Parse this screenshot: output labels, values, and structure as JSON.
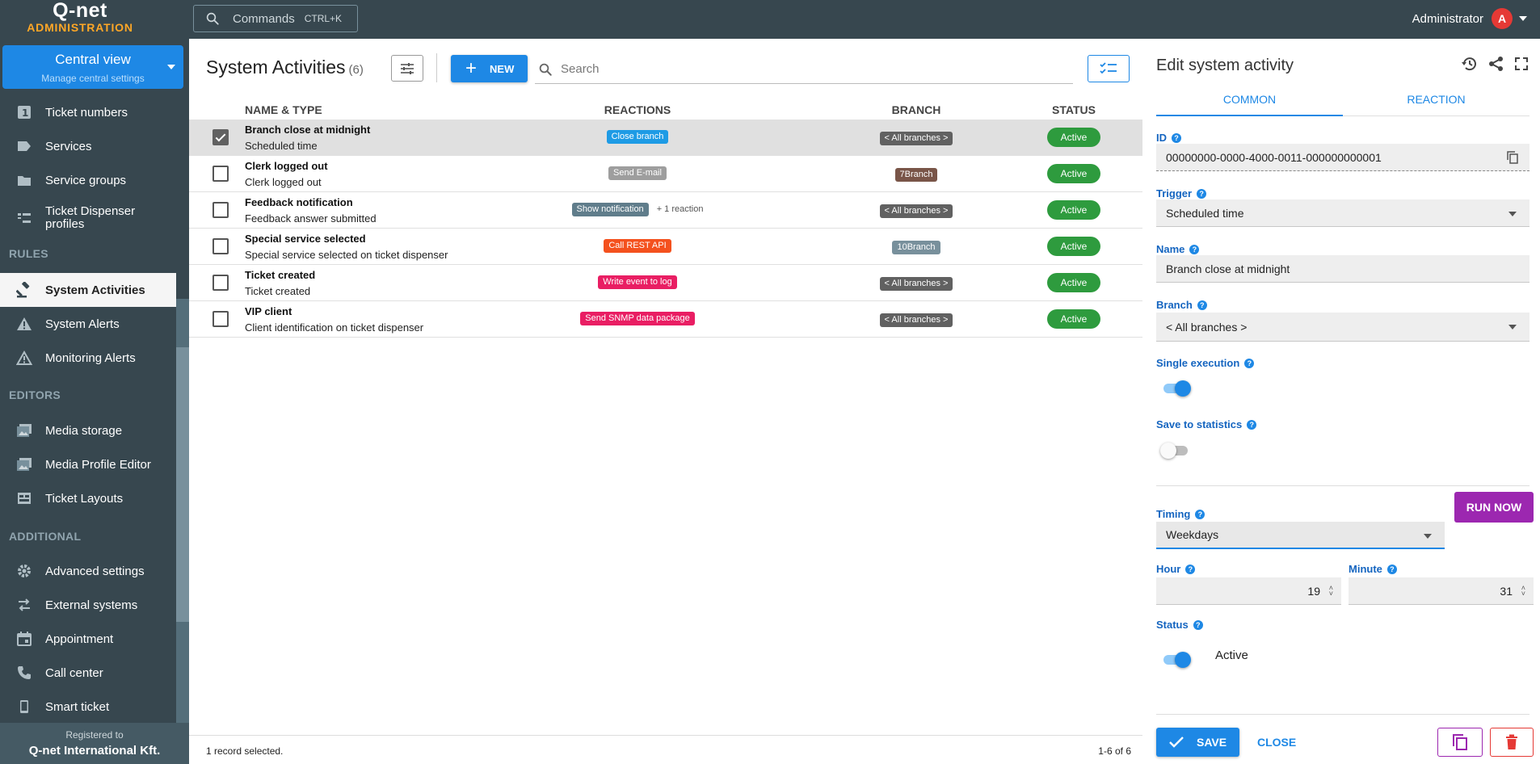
{
  "header": {
    "logo": "Q-net",
    "logo_sub": "ADMINISTRATION",
    "commands_label": "Commands",
    "commands_shortcut": "CTRL+K",
    "user_name": "Administrator",
    "user_initial": "A"
  },
  "sidebar": {
    "central": {
      "title": "Central view",
      "subtitle": "Manage central settings"
    },
    "items": [
      {
        "label": "Ticket numbers",
        "icon": "number-icon"
      },
      {
        "label": "Services",
        "icon": "label-icon"
      },
      {
        "label": "Service groups",
        "icon": "folder-icon"
      },
      {
        "label": "Ticket Dispenser profiles",
        "icon": "dispenser-icon"
      }
    ],
    "rules_title": "RULES",
    "rules": [
      {
        "label": "System Activities",
        "icon": "gavel-icon",
        "active": true
      },
      {
        "label": "System Alerts",
        "icon": "warning-icon"
      },
      {
        "label": "Monitoring Alerts",
        "icon": "warning-outline-icon"
      }
    ],
    "editors_title": "EDITORS",
    "editors": [
      {
        "label": "Media storage",
        "icon": "images-icon"
      },
      {
        "label": "Media Profile Editor",
        "icon": "images-edit-icon"
      },
      {
        "label": "Ticket Layouts",
        "icon": "layout-icon"
      }
    ],
    "additional_title": "ADDITIONAL",
    "additional": [
      {
        "label": "Advanced settings",
        "icon": "gear-icon"
      },
      {
        "label": "External systems",
        "icon": "swap-icon"
      },
      {
        "label": "Appointment",
        "icon": "calendar-icon"
      },
      {
        "label": "Call center",
        "icon": "phone-icon"
      },
      {
        "label": "Smart ticket",
        "icon": "smartphone-icon"
      }
    ],
    "footer_line1": "Registered to",
    "footer_line2": "Q-net International Kft."
  },
  "main": {
    "title": "System Activities",
    "count": "(6)",
    "new_label": "NEW",
    "search_placeholder": "Search",
    "columns": {
      "name": "NAME & TYPE",
      "reactions": "REACTIONS",
      "branch": "BRANCH",
      "status": "STATUS"
    },
    "rows": [
      {
        "name": "Branch close at midnight",
        "type": "Scheduled time",
        "reaction": "Close branch",
        "reaction_color": "#1e9be5",
        "extra": "",
        "branch": "< All branches >",
        "branch_color": "#616161",
        "status": "Active",
        "selected": true
      },
      {
        "name": "Clerk logged out",
        "type": "Clerk logged out",
        "reaction": "Send E-mail",
        "reaction_color": "#9e9e9e",
        "extra": "",
        "branch": "7Branch",
        "branch_color": "#795548",
        "status": "Active",
        "selected": false
      },
      {
        "name": "Feedback notification",
        "type": "Feedback answer submitted",
        "reaction": "Show notification",
        "reaction_color": "#607d8b",
        "extra": "+ 1 reaction",
        "branch": "< All branches >",
        "branch_color": "#616161",
        "status": "Active",
        "selected": false
      },
      {
        "name": "Special service selected",
        "type": "Special service selected on ticket dispenser",
        "reaction": "Call REST API",
        "reaction_color": "#f4511e",
        "extra": "",
        "branch": "10Branch",
        "branch_color": "#78909c",
        "status": "Active",
        "selected": false
      },
      {
        "name": "Ticket created",
        "type": "Ticket created",
        "reaction": "Write event to log",
        "reaction_color": "#e91e63",
        "extra": "",
        "branch": "< All branches >",
        "branch_color": "#616161",
        "status": "Active",
        "selected": false
      },
      {
        "name": "VIP client",
        "type": "Client identification on ticket dispenser",
        "reaction": "Send SNMP data package",
        "reaction_color": "#e91e63",
        "extra": "",
        "branch": "< All branches >",
        "branch_color": "#616161",
        "status": "Active",
        "selected": false
      }
    ],
    "footer_left": "1 record selected.",
    "footer_right": "1-6 of 6"
  },
  "panel": {
    "title": "Edit system activity",
    "tabs": [
      "COMMON",
      "REACTION"
    ],
    "id_label": "ID",
    "id_value": "00000000-0000-4000-0011-000000000001",
    "trigger_label": "Trigger",
    "trigger_value": "Scheduled time",
    "name_label": "Name",
    "name_value": "Branch close at midnight",
    "branch_label": "Branch",
    "branch_value": "< All branches >",
    "single_label": "Single execution",
    "single_on": true,
    "stats_label": "Save to statistics",
    "stats_on": false,
    "timing_label": "Timing",
    "timing_value": "Weekdays",
    "run_now": "RUN NOW",
    "hour_label": "Hour",
    "hour_value": "19",
    "minute_label": "Minute",
    "minute_value": "31",
    "status_label": "Status",
    "status_value": "Active",
    "status_on": true,
    "save_label": "SAVE",
    "close_label": "CLOSE"
  }
}
